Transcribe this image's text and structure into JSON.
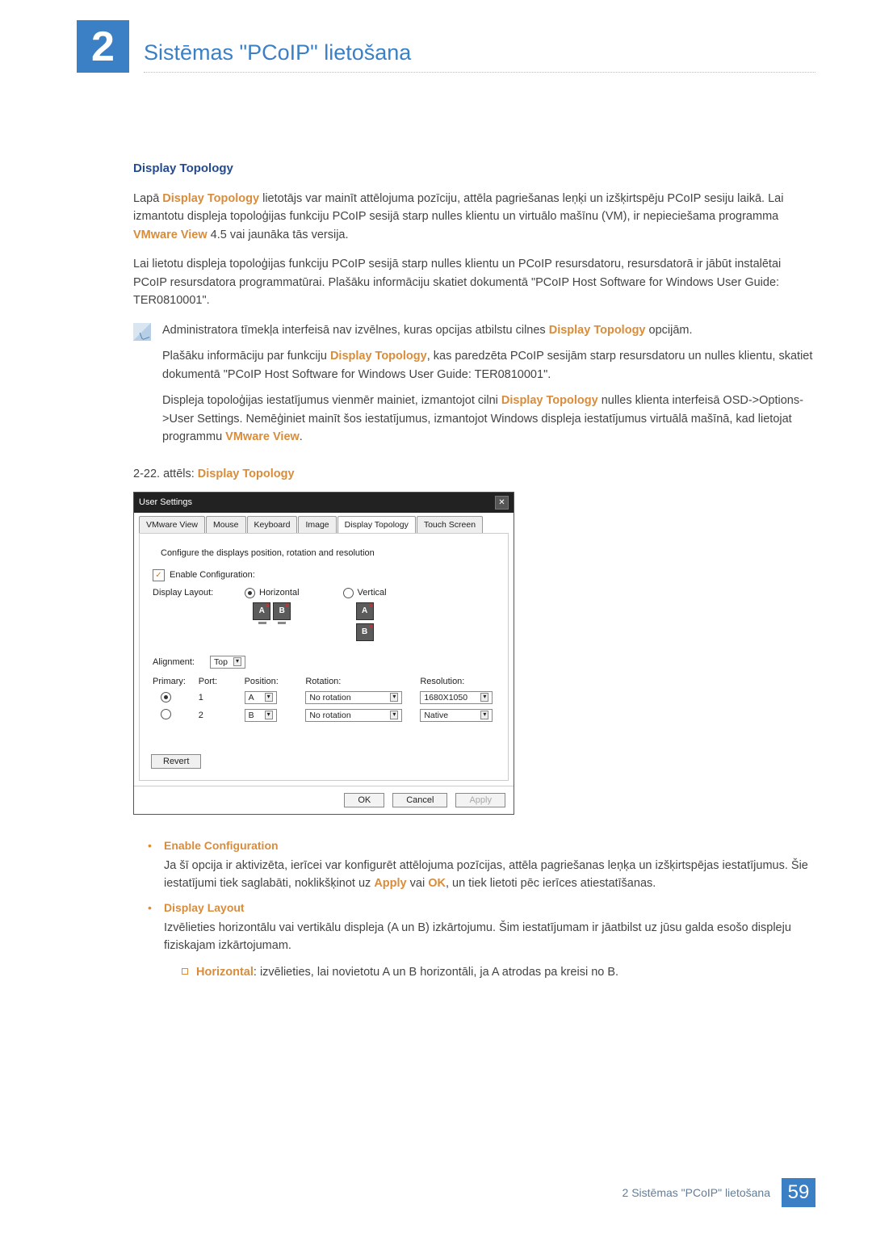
{
  "chapter": {
    "number": "2",
    "title": "Sistēmas \"PCoIP\" lietošana"
  },
  "section_title": "Display Topology",
  "intro_p1_pre": "Lapā ",
  "intro_p1_b1": "Display Topology",
  "intro_p1_mid": " lietotājs var mainīt attēlojuma pozīciju, attēla pagriešanas leņķi un izšķirtspēju PCoIP sesiju laikā. Lai izmantotu displeja topoloģijas funkciju PCoIP sesijā starp nulles klientu un virtuālo mašīnu (VM), ir nepieciešama programma ",
  "intro_p1_b2": "VMware View",
  "intro_p1_post": " 4.5 vai jaunāka tās versija.",
  "intro_p2": "Lai lietotu displeja topoloģijas funkciju PCoIP sesijā starp nulles klientu un PCoIP resursdatoru, resursdatorā ir jābūt instalētai PCoIP resursdatora programmatūrai. Plašāku informāciju skatiet dokumentā \"PCoIP Host Software for Windows User Guide: TER0810001\".",
  "note": {
    "p1_pre": "Administratora tīmekļa interfeisā nav izvēlnes, kuras opcijas atbilstu cilnes ",
    "p1_b1": "Display Topology",
    "p1_post": " opcijām.",
    "p2_pre": "Plašāku informāciju par funkciju ",
    "p2_b1": "Display Topology",
    "p2_post": ", kas paredzēta PCoIP sesijām starp resursdatoru un nulles klientu, skatiet dokumentā \"PCoIP Host Software for Windows User Guide: TER0810001\".",
    "p3_pre": "Displeja topoloģijas iestatījumus vienmēr mainiet, izmantojot cilni ",
    "p3_b1": "Display Topology",
    "p3_mid": " nulles klienta interfeisā OSD->Options->User Settings. Nemēģiniet mainīt šos iestatījumus, izmantojot Windows displeja iestatījumus virtuālā mašīnā, kad lietojat programmu ",
    "p3_b2": "VMware View",
    "p3_post": "."
  },
  "figure": {
    "caption_pre": "2-22. attēls: ",
    "caption_b": "Display Topology"
  },
  "panel": {
    "title": "User Settings",
    "tabs": [
      "VMware View",
      "Mouse",
      "Keyboard",
      "Image",
      "Display Topology",
      "Touch Screen"
    ],
    "active_tab_index": 4,
    "config_line": "Configure the displays position, rotation and resolution",
    "enable_label": "Enable Configuration:",
    "layout_label": "Display Layout:",
    "horizontal": "Horizontal",
    "vertical": "Vertical",
    "alignment_label": "Alignment:",
    "alignment_value": "Top",
    "headers": {
      "primary": "Primary:",
      "port": "Port:",
      "position": "Position:",
      "rotation": "Rotation:",
      "resolution": "Resolution:"
    },
    "rows": [
      {
        "primary": true,
        "port": "1",
        "position": "A",
        "rotation": "No rotation",
        "resolution": "1680X1050"
      },
      {
        "primary": false,
        "port": "2",
        "position": "B",
        "rotation": "No rotation",
        "resolution": "Native"
      }
    ],
    "revert": "Revert",
    "ok": "OK",
    "cancel": "Cancel",
    "apply": "Apply"
  },
  "bullets": {
    "b1_title": "Enable Configuration",
    "b1_body_pre": "Ja šī opcija ir aktivizēta, ierīcei var konfigurēt attēlojuma pozīcijas, attēla pagriešanas leņķa un izšķirtspējas iestatījumus. Šie iestatījumi tiek saglabāti, noklikšķinot uz ",
    "b1_body_a": "Apply",
    "b1_body_or": " vai ",
    "b1_body_ok": "OK",
    "b1_body_post": ", un tiek lietoti pēc ierīces atiestatīšanas.",
    "b2_title": "Display Layout",
    "b2_body": "Izvēlieties horizontālu vai vertikālu displeja (A un B) izkārtojumu. Šim iestatījumam ir jāatbilst uz jūsu galda esošo displeju fiziskajam izkārtojumam.",
    "b2_sub_b": "Horizontal",
    "b2_sub_post": ": izvēlieties, lai novietotu A un B horizontāli, ja A atrodas pa kreisi no B."
  },
  "footer": {
    "text": "2 Sistēmas \"PCoIP\" lietošana",
    "page": "59"
  }
}
